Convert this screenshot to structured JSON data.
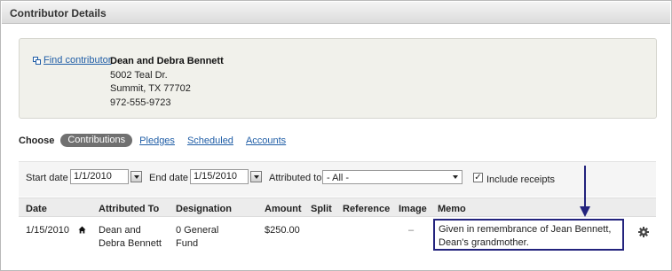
{
  "header": {
    "title": "Contributor Details"
  },
  "contributor": {
    "find_label": "Find contributor",
    "name": "Dean and Debra Bennett",
    "address_line1": "5002 Teal Dr.",
    "address_line2": "Summit, TX 77702",
    "phone": "972-555-9723"
  },
  "choose": {
    "label": "Choose",
    "tabs": [
      {
        "label": "Contributions",
        "active": true
      },
      {
        "label": "Pledges"
      },
      {
        "label": "Scheduled"
      },
      {
        "label": "Accounts"
      }
    ]
  },
  "filters": {
    "start_date_label": "Start date",
    "start_date": "1/1/2010",
    "end_date_label": "End date",
    "end_date": "1/15/2010",
    "attributed_label": "Attributed to",
    "attributed_value": "- All -",
    "include_receipts_label": "Include receipts",
    "include_receipts_checked": true
  },
  "table": {
    "columns": [
      "Date",
      "Attributed To",
      "Designation",
      "Amount",
      "Split",
      "Reference",
      "Image",
      "Memo"
    ],
    "rows": [
      {
        "date": "1/15/2010",
        "attributed_to": "Dean and Debra Bennett",
        "designation": "0 General Fund",
        "amount": "$250.00",
        "split": "",
        "reference": "",
        "image": "–",
        "memo": "Given in remembrance of Jean Bennett, Dean's grandmother."
      }
    ]
  },
  "colors": {
    "link": "#1f5da6",
    "annotation": "#23237d",
    "pill": "#707070"
  },
  "icons": [
    "find-contributor-icon",
    "calendar-icon",
    "home-icon",
    "gear-icon",
    "dropdown-icon",
    "annotation-arrow"
  ]
}
